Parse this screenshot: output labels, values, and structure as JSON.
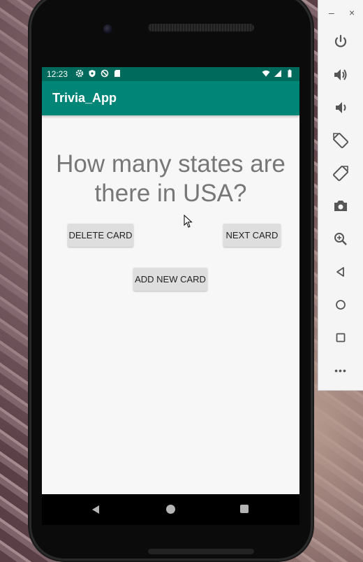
{
  "status_bar": {
    "time": "12:23"
  },
  "app_bar": {
    "title": "Trivia_App"
  },
  "question": {
    "text": "How many states are there in USA?"
  },
  "buttons": {
    "delete_label": "DELETE CARD",
    "next_label": "NEXT CARD",
    "add_label": "ADD NEW CARD"
  },
  "emulator_panel": {
    "minimize_label": "–",
    "close_label": "×",
    "tools": [
      "power-icon",
      "volume-up-icon",
      "volume-down-icon",
      "rotate-left-icon",
      "rotate-right-icon",
      "camera-icon",
      "zoom-icon",
      "back-icon",
      "home-icon",
      "overview-icon",
      "more-icon"
    ],
    "more_label": "•••"
  },
  "colors": {
    "status_bar": "#006b5c",
    "app_bar": "#008577",
    "screen_bg": "#f7f7f7",
    "question_text": "#777777",
    "button_bg": "#dedede"
  }
}
